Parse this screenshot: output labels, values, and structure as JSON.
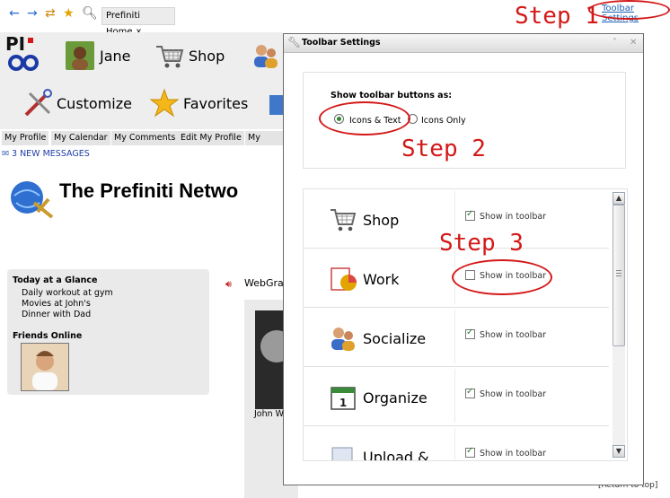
{
  "browser": {
    "home_tab_label": "Prefiniti Home",
    "home_tab_close": "x",
    "toolbar_settings_link": "Toolbar Settings"
  },
  "annotations": {
    "step1": "Step 1",
    "step2": "Step 2",
    "step3": "Step 3",
    "annotation_color": "#d41818"
  },
  "toolbar": {
    "user": "Jane",
    "shop": "Shop",
    "customize": "Customize",
    "favorites": "Favorites"
  },
  "subnav": [
    "My Profile",
    "My Calendar",
    "My Comments",
    "Edit My Profile",
    "My Best"
  ],
  "messages": "3 NEW MESSAGES",
  "page_title": "The Prefiniti Netwo",
  "glance": {
    "title": "Today at a Glance",
    "items": [
      "Daily workout at gym",
      "Movies at John's",
      "Dinner with Dad"
    ],
    "friends_title": "Friends Online"
  },
  "webgrab_label": "WebGra",
  "friend_caption": "John W",
  "dialog": {
    "title": "Toolbar Settings",
    "show_as_heading": "Show toolbar buttons as:",
    "option_icons_text": "Icons & Text",
    "option_icons_only": "Icons Only",
    "selected_option": "Icons & Text",
    "rows": [
      {
        "name": "Shop",
        "checkbox_label": "Show in toolbar",
        "checked": true,
        "icon": "shopping-cart-icon"
      },
      {
        "name": "Work",
        "checkbox_label": "Show in toolbar",
        "checked": false,
        "icon": "work-pie-chart-icon"
      },
      {
        "name": "Socialize",
        "checkbox_label": "Show in toolbar",
        "checked": true,
        "icon": "people-icon"
      },
      {
        "name": "Organize",
        "checkbox_label": "Show in toolbar",
        "checked": true,
        "icon": "calendar-icon"
      },
      {
        "name": "Upload &",
        "checkbox_label": "Show in toolbar",
        "checked": true,
        "icon": "upload-icon"
      }
    ]
  },
  "return_to_top": "[Return to top]"
}
